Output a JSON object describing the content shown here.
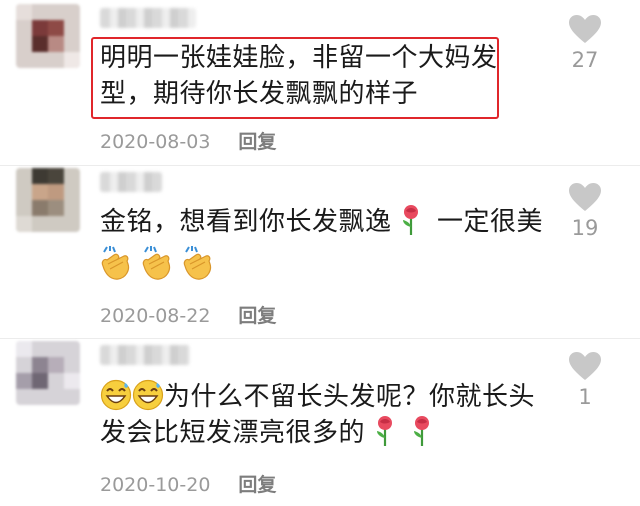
{
  "comments": [
    {
      "text_line1": "明明一张娃娃脸，非留一个大妈发",
      "text_line2": "型，期待你长发飘飘的样子",
      "date": "2020-08-03",
      "reply_label": "回复",
      "likes": "27",
      "highlighted": true
    },
    {
      "text_line1": "金铭，想看到你长发飘逸",
      "text_line1_after": "一定很美",
      "date": "2020-08-22",
      "reply_label": "回复",
      "likes": "19"
    },
    {
      "text_line1": "为什么不留长头发呢？你就长头",
      "text_line2": "发会比短发漂亮很多的",
      "date": "2020-10-20",
      "reply_label": "回复",
      "likes": "1"
    }
  ],
  "colors": {
    "highlight_border": "#e0262b",
    "meta_text": "#9a9a9a",
    "like_icon": "#c8c8c8"
  },
  "icons": [
    "heart-icon",
    "rose-emoji",
    "clap-emoji",
    "grin-sweat-emoji"
  ]
}
